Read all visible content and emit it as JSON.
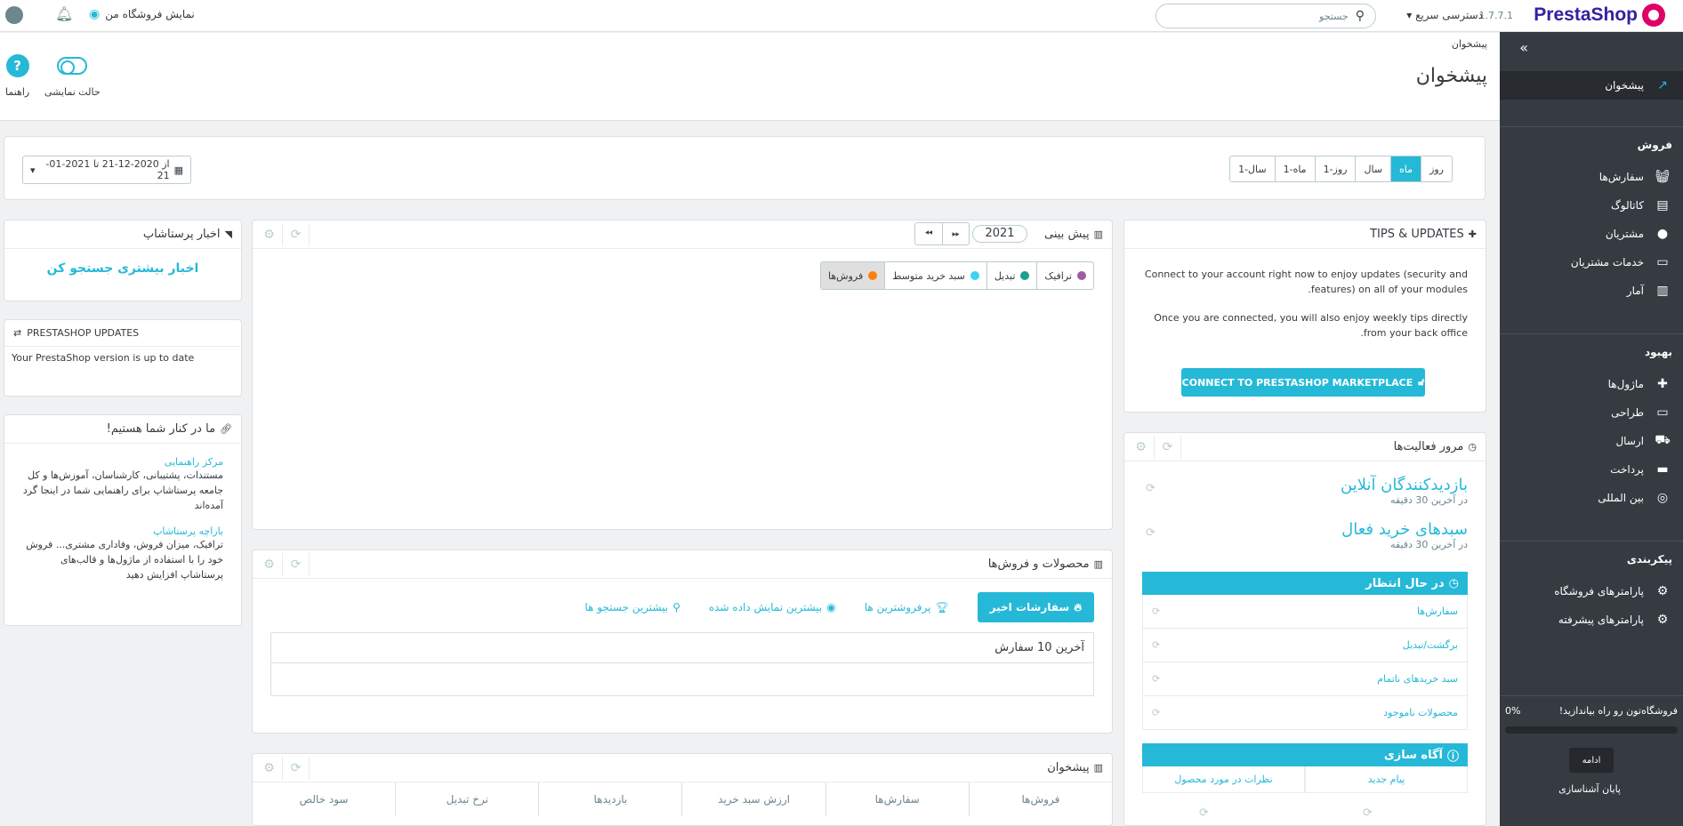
{
  "header": {
    "brand": "PrestaShop",
    "version": "1.7.7.1",
    "quick_access": "دسترسی سریع ▾",
    "search_placeholder": "جستجو",
    "view_shop": "نمایش فروشگاه من"
  },
  "sidebar": {
    "dashboard": "پیشخوان",
    "sections": [
      {
        "title": "فروش",
        "items": [
          "سفارش‌ها",
          "کاتالوگ",
          "مشتریان",
          "خدمات مشتریان",
          "آمار"
        ]
      },
      {
        "title": "بهبود",
        "items": [
          "ماژول‌ها",
          "طراحی",
          "ارسال",
          "پرداخت",
          "بین المللی"
        ]
      },
      {
        "title": "پیکربندی",
        "items": [
          "پارامترهای فروشگاه",
          "پارامترهای پیشرفته"
        ]
      }
    ],
    "onboarding_text": "فروشگاه‌تون رو راه بیاندازید!",
    "onboarding_percent": "0%",
    "onboarding_progress": 0,
    "continue_label": "ادامه",
    "end_label": "پایان آشناسازی"
  },
  "page": {
    "breadcrumb": "پیشخوان",
    "title": "پیشخوان",
    "toolbar": {
      "demo_mode": "حالت نمایشی",
      "help": "راهنما"
    }
  },
  "datebar": {
    "periods": [
      "روز",
      "ماه",
      "سال",
      "روز-1",
      "ماه-1",
      "سال-1"
    ],
    "active_period": "ماه",
    "range": "از 2020-12-21 تا 2021-01-21"
  },
  "tips": {
    "title": "TIPS & UPDATES",
    "p1": "Connect to your account right now to enjoy updates (security and features) on all of your modules.",
    "p2": "Once you are connected, you will also enjoy weekly tips directly from your back office.",
    "button": "CONNECT TO PRESTASHOP MARKETPLACE"
  },
  "activity": {
    "title": "مرور فعالیت‌ها",
    "visitors": "بازدیدکنندگان آنلاین",
    "visitors_sub": "در آخرین 30 دقیقه",
    "carts": "سبدهای خرید فعال",
    "carts_sub": "در آخرین 30 دقیقه",
    "pending_title": "در حال انتظار",
    "pending_items": [
      "سفارش‌ها",
      "برگشت/تبدیل",
      "سبد خریدهای ناتمام",
      "محصولات ناموجود"
    ],
    "notif_title": "آگاه سازی",
    "notif_items": [
      "پیام جدید",
      "نظرات در مورد محصول"
    ]
  },
  "forecast": {
    "title": "پیش بینی",
    "year": "2021",
    "legend": [
      {
        "label": "ترافیک",
        "color": "#9e5ba1"
      },
      {
        "label": "تبدیل",
        "color": "#1e9f8f"
      },
      {
        "label": "سبد خرید متوسط",
        "color": "#3ed2f0"
      },
      {
        "label": "فروش‌ها",
        "color": "#ff7f0e"
      }
    ]
  },
  "products": {
    "title": "محصولات و فروش‌ها",
    "tabs": [
      "سفارشات اخیر",
      "پرفروشترین ها",
      "بیشترین نمایش داده شده",
      "بیشترین جستجو ها"
    ],
    "table_caption": "آخرین 10 سفارش"
  },
  "dashboard_panel": {
    "title": "پیشخوان",
    "columns": [
      "فروش‌ها",
      "سفارش‌ها",
      "ارزش سبد خرید",
      "بازدیدها",
      "نرخ تبدیل",
      "سود خالص"
    ]
  },
  "news": {
    "title": "اخبار پرستاشاپ",
    "link": "اخبار بیشتری جستجو کن"
  },
  "ps_updates": {
    "title": "PRESTASHOP UPDATES",
    "text": "Your PrestaShop version is up to date"
  },
  "support": {
    "title": "ما در کنار شما هستیم!",
    "help_title": "مرکز راهنمایی",
    "help_desc": "مستندات، پشتیبانی، کارشناسان، آموزش‌ها و کل جامعه پرستاشاپ برای راهنمایی شما در اینجا گرد آمده‌اند",
    "market_title": "بازاچه پرستاشاپ",
    "market_desc": "ترافیک، میزان فروش، وفاداری مشتری... فروش خود را با استفاده از ماژول‌ها و قالب‌های پرستاشاپ افزایش دهید"
  }
}
